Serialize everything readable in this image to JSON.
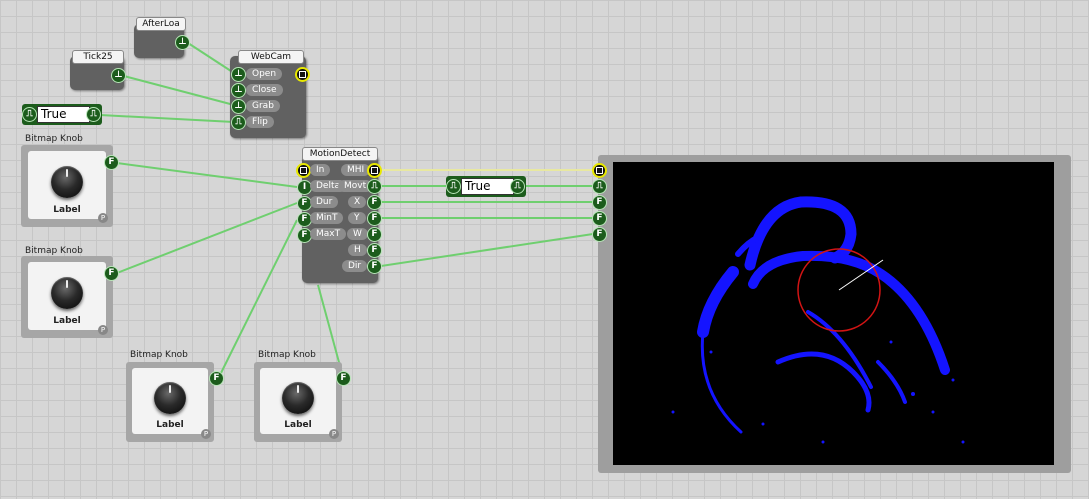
{
  "nodes": {
    "afterload": {
      "title": "AfterLoa"
    },
    "tick25": {
      "title": "Tick25"
    },
    "webcam": {
      "title": "WebCam",
      "inputs": [
        "Open",
        "Close",
        "Grab",
        "Flip"
      ]
    },
    "true_left": {
      "value": "True"
    },
    "true_right": {
      "value": "True"
    },
    "motion_detect": {
      "title": "MotionDetect",
      "inputs": [
        "In",
        "Delta",
        "Dur",
        "MinT",
        "MaxT"
      ],
      "outputs": [
        "MHI",
        "Movt",
        "X",
        "Y",
        "W",
        "H",
        "Dir"
      ]
    }
  },
  "knobs": [
    {
      "title": "Bitmap Knob",
      "label": "Label",
      "badge": "P"
    },
    {
      "title": "Bitmap Knob",
      "label": "Label",
      "badge": "P"
    },
    {
      "title": "Bitmap Knob",
      "label": "Label",
      "badge": "P"
    },
    {
      "title": "Bitmap Knob",
      "label": "Label",
      "badge": "P"
    }
  ],
  "pin_glyphs": {
    "trigger": "⊥",
    "float": "F",
    "integer": "I",
    "pulse": "⎍",
    "bitmap": "▢"
  },
  "colors": {
    "wire": "#6fcf6f",
    "bitmap_wire": "#e8e8a0",
    "motion": "#1414ff",
    "tracker_circle": "#d21414",
    "canvas": "#d6d6d6"
  }
}
